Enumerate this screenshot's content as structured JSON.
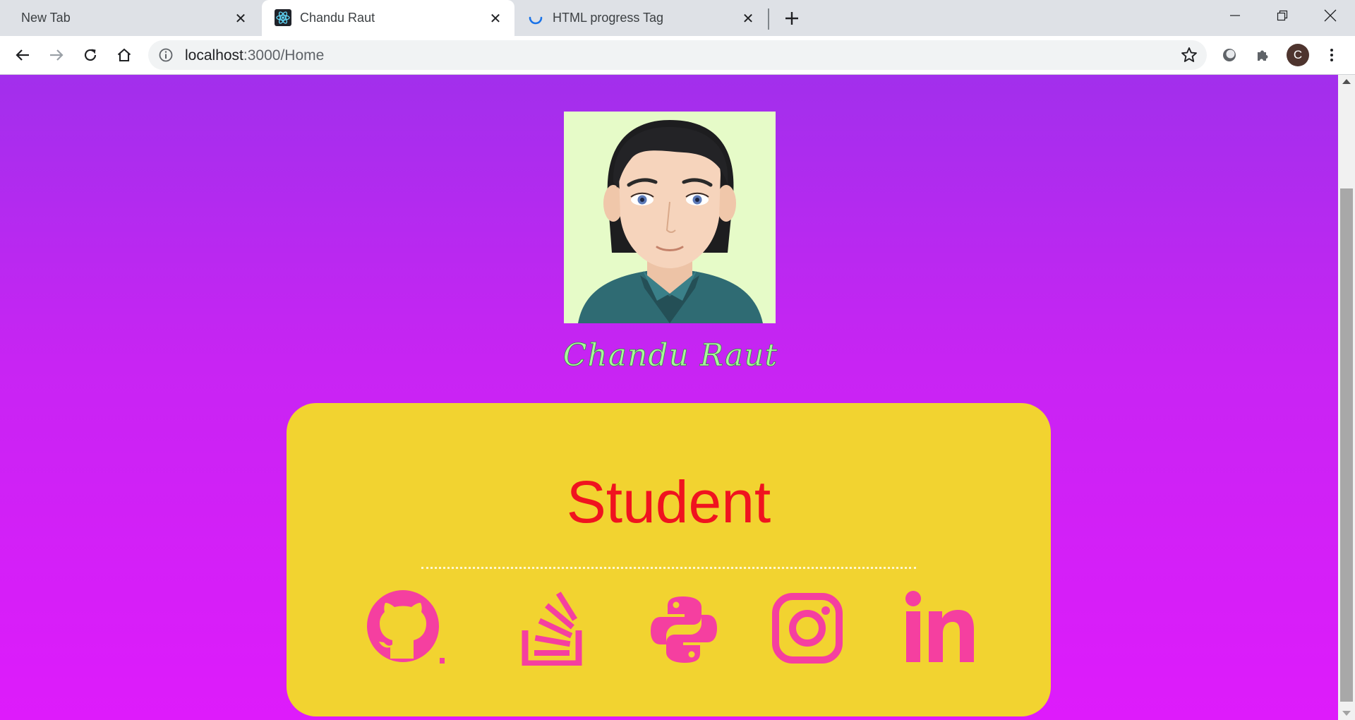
{
  "browser": {
    "tabs": [
      {
        "label": "New Tab"
      },
      {
        "label": "Chandu Raut"
      },
      {
        "label": "HTML progress Tag"
      }
    ],
    "url_host": "localhost",
    "url_path": ":3000/Home",
    "avatar_initial": "C"
  },
  "page": {
    "profile_name": "Chandu Raut",
    "card_title": "Student",
    "social_links": [
      {
        "icon": "github-icon"
      },
      {
        "icon": "stackoverflow-icon"
      },
      {
        "icon": "python-icon"
      },
      {
        "icon": "instagram-icon"
      },
      {
        "icon": "linkedin-icon"
      }
    ]
  },
  "colors": {
    "gradient_top": "#a22fec",
    "gradient_bottom": "#de1bfb",
    "card_background": "#f2d330",
    "card_title": "#f0131f",
    "social_icons": "#f53fa0",
    "profile_name": "#a8f59a"
  }
}
